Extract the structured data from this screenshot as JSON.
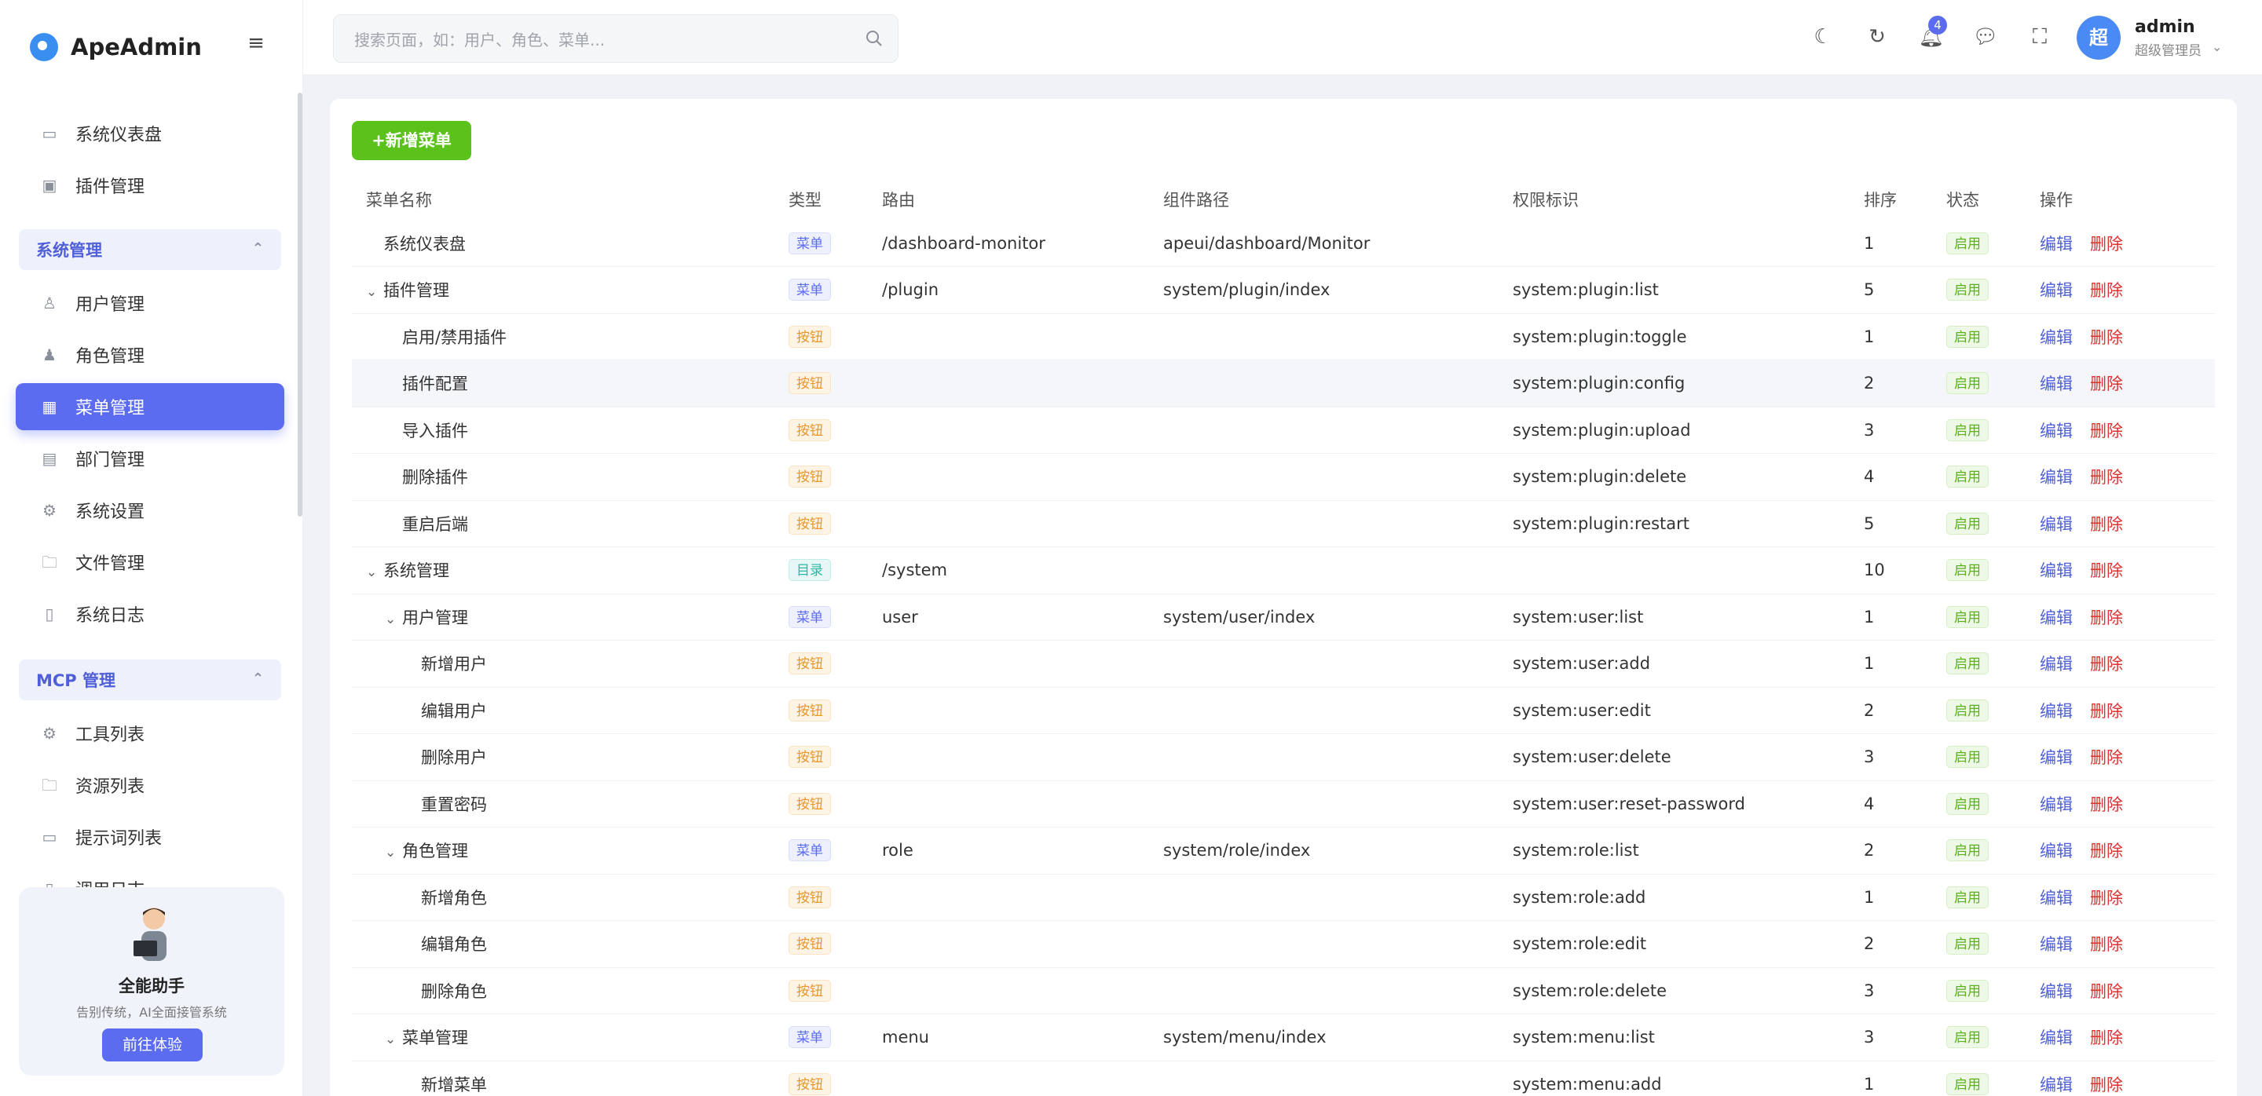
{
  "app": {
    "name": "ApeAdmin"
  },
  "sidebar": {
    "top_items": [
      {
        "label": "系统仪表盘",
        "icon": "monitor-icon"
      },
      {
        "label": "插件管理",
        "icon": "plugin-icon"
      }
    ],
    "groups": [
      {
        "title": "系统管理",
        "items": [
          {
            "label": "用户管理",
            "icon": "user-icon"
          },
          {
            "label": "角色管理",
            "icon": "role-icon"
          },
          {
            "label": "菜单管理",
            "icon": "menu-grid-icon",
            "active": true
          },
          {
            "label": "部门管理",
            "icon": "department-icon"
          },
          {
            "label": "系统设置",
            "icon": "gear-icon"
          },
          {
            "label": "文件管理",
            "icon": "folder-icon"
          },
          {
            "label": "系统日志",
            "icon": "log-icon"
          }
        ]
      },
      {
        "title": "MCP 管理",
        "items": [
          {
            "label": "工具列表",
            "icon": "gear-icon"
          },
          {
            "label": "资源列表",
            "icon": "folder-icon"
          },
          {
            "label": "提示词列表",
            "icon": "chat-icon"
          },
          {
            "label": "调用日志",
            "icon": "log-icon"
          }
        ]
      }
    ],
    "promo": {
      "title": "全能助手",
      "subtitle": "告别传统，AI全面接管系统",
      "button": "前往体验"
    }
  },
  "header": {
    "search_placeholder": "搜索页面，如：用户、角色、菜单...",
    "notification_count": "4",
    "user": {
      "avatar_char": "超",
      "name": "admin",
      "role": "超级管理员"
    }
  },
  "toolbar": {
    "add_label": "+新增菜单"
  },
  "table": {
    "columns": [
      "菜单名称",
      "类型",
      "路由",
      "组件路径",
      "权限标识",
      "排序",
      "状态",
      "操作"
    ],
    "actions": {
      "edit": "编辑",
      "delete": "删除"
    },
    "rows": [
      {
        "name": "系统仪表盘",
        "level": 0,
        "expanded": false,
        "type": "菜单",
        "route": "/dashboard-monitor",
        "component": "apeui/dashboard/Monitor",
        "permission": "",
        "sort": "1",
        "status": "启用"
      },
      {
        "name": "插件管理",
        "level": 0,
        "expanded": true,
        "type": "菜单",
        "route": "/plugin",
        "component": "system/plugin/index",
        "permission": "system:plugin:list",
        "sort": "5",
        "status": "启用"
      },
      {
        "name": "启用/禁用插件",
        "level": 1,
        "expanded": false,
        "type": "按钮",
        "route": "",
        "component": "",
        "permission": "system:plugin:toggle",
        "sort": "1",
        "status": "启用"
      },
      {
        "name": "插件配置",
        "level": 1,
        "expanded": false,
        "type": "按钮",
        "route": "",
        "component": "",
        "permission": "system:plugin:config",
        "sort": "2",
        "status": "启用"
      },
      {
        "name": "导入插件",
        "level": 1,
        "expanded": false,
        "type": "按钮",
        "route": "",
        "component": "",
        "permission": "system:plugin:upload",
        "sort": "3",
        "status": "启用"
      },
      {
        "name": "删除插件",
        "level": 1,
        "expanded": false,
        "type": "按钮",
        "route": "",
        "component": "",
        "permission": "system:plugin:delete",
        "sort": "4",
        "status": "启用"
      },
      {
        "name": "重启后端",
        "level": 1,
        "expanded": false,
        "type": "按钮",
        "route": "",
        "component": "",
        "permission": "system:plugin:restart",
        "sort": "5",
        "status": "启用"
      },
      {
        "name": "系统管理",
        "level": 0,
        "expanded": true,
        "type": "目录",
        "route": "/system",
        "component": "",
        "permission": "",
        "sort": "10",
        "status": "启用"
      },
      {
        "name": "用户管理",
        "level": 1,
        "expanded": true,
        "type": "菜单",
        "route": "user",
        "component": "system/user/index",
        "permission": "system:user:list",
        "sort": "1",
        "status": "启用"
      },
      {
        "name": "新增用户",
        "level": 2,
        "expanded": false,
        "type": "按钮",
        "route": "",
        "component": "",
        "permission": "system:user:add",
        "sort": "1",
        "status": "启用"
      },
      {
        "name": "编辑用户",
        "level": 2,
        "expanded": false,
        "type": "按钮",
        "route": "",
        "component": "",
        "permission": "system:user:edit",
        "sort": "2",
        "status": "启用"
      },
      {
        "name": "删除用户",
        "level": 2,
        "expanded": false,
        "type": "按钮",
        "route": "",
        "component": "",
        "permission": "system:user:delete",
        "sort": "3",
        "status": "启用"
      },
      {
        "name": "重置密码",
        "level": 2,
        "expanded": false,
        "type": "按钮",
        "route": "",
        "component": "",
        "permission": "system:user:reset-password",
        "sort": "4",
        "status": "启用"
      },
      {
        "name": "角色管理",
        "level": 1,
        "expanded": true,
        "type": "菜单",
        "route": "role",
        "component": "system/role/index",
        "permission": "system:role:list",
        "sort": "2",
        "status": "启用"
      },
      {
        "name": "新增角色",
        "level": 2,
        "expanded": false,
        "type": "按钮",
        "route": "",
        "component": "",
        "permission": "system:role:add",
        "sort": "1",
        "status": "启用"
      },
      {
        "name": "编辑角色",
        "level": 2,
        "expanded": false,
        "type": "按钮",
        "route": "",
        "component": "",
        "permission": "system:role:edit",
        "sort": "2",
        "status": "启用"
      },
      {
        "name": "删除角色",
        "level": 2,
        "expanded": false,
        "type": "按钮",
        "route": "",
        "component": "",
        "permission": "system:role:delete",
        "sort": "3",
        "status": "启用"
      },
      {
        "name": "菜单管理",
        "level": 1,
        "expanded": true,
        "type": "菜单",
        "route": "menu",
        "component": "system/menu/index",
        "permission": "system:menu:list",
        "sort": "3",
        "status": "启用"
      },
      {
        "name": "新增菜单",
        "level": 2,
        "expanded": false,
        "type": "按钮",
        "route": "",
        "component": "",
        "permission": "system:menu:add",
        "sort": "1",
        "status": "启用"
      }
    ]
  },
  "colors": {
    "primary": "#5b6cf0",
    "success": "#5bc21b",
    "danger": "#e03131"
  }
}
